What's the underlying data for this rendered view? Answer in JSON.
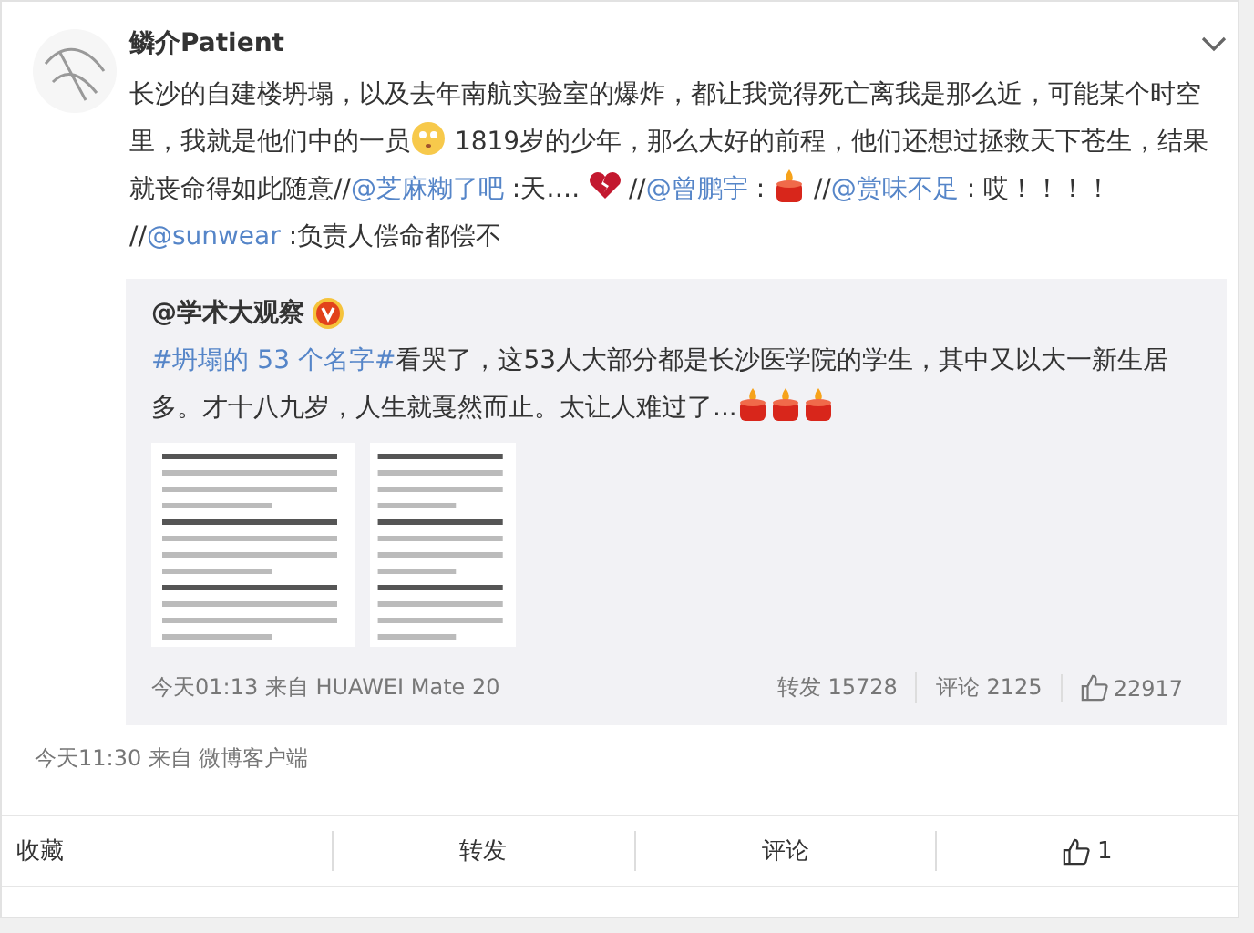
{
  "post": {
    "author": "鳞介Patient",
    "body": [
      {
        "kind": "text",
        "text": "长沙的自建楼坍塌，以及去年南航实验室的爆炸，都让我觉得死亡离我是那么近，可能某个时空里，我就是他们中的一员"
      },
      {
        "kind": "face"
      },
      {
        "kind": "text",
        "text": " 1819岁的少年，那么大好的前程，他们还想过拯救天下苍生，结果就丧命得如此随意//"
      },
      {
        "kind": "mention",
        "text": "@芝麻糊了吧"
      },
      {
        "kind": "text",
        "text": " :天…. "
      },
      {
        "kind": "heart"
      },
      {
        "kind": "text",
        "text": " //"
      },
      {
        "kind": "mention",
        "text": "@曾鹏宇"
      },
      {
        "kind": "text",
        "text": " : "
      },
      {
        "kind": "candle"
      },
      {
        "kind": "text",
        "text": " //"
      },
      {
        "kind": "mention",
        "text": "@赏味不足"
      },
      {
        "kind": "text",
        "text": " : 哎！！！！ //"
      },
      {
        "kind": "mention",
        "text": "@sunwear"
      },
      {
        "kind": "text",
        "text": " :负责人偿命都偿不"
      }
    ],
    "repost": {
      "author": "@学术大观察",
      "verified": true,
      "body": [
        {
          "kind": "topic",
          "text": "#坍塌的 53 个名字#"
        },
        {
          "kind": "text",
          "text": "看哭了，这53人大部分都是长沙医学院的学生，其中又以大一新生居多。才十八九岁，人生就戛然而止。太让人难过了..."
        },
        {
          "kind": "candle"
        },
        {
          "kind": "candle"
        },
        {
          "kind": "candle"
        }
      ],
      "source": "今天01:13 来自 HUAWEI Mate 20",
      "reposts": "转发 15728",
      "comments": "评论 2125",
      "likes": "22917"
    },
    "source": "今天11:30  来自 微博客户端",
    "actions": [
      {
        "kind": "text",
        "label": "收藏"
      },
      {
        "kind": "text",
        "label": "转发"
      },
      {
        "kind": "text",
        "label": "评论"
      },
      {
        "kind": "like",
        "label": "1"
      }
    ]
  }
}
